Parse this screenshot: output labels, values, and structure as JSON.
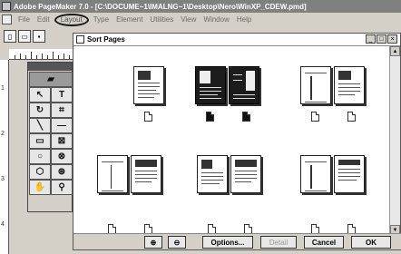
{
  "app": {
    "title": "Adobe PageMaker 7.0 - [C:\\DOCUME~1\\IMALNG~1\\Desktop\\Nero\\WinXP_CDEW.pmd]"
  },
  "menu": {
    "items": [
      "File",
      "Edit",
      "Layout",
      "Type",
      "Element",
      "Utilities",
      "View",
      "Window",
      "Help"
    ],
    "highlighted": "Layout"
  },
  "ruler": {
    "left_numbers": [
      "1",
      "2",
      "3",
      "4"
    ]
  },
  "toolbox": {
    "tools": [
      {
        "name": "pointer-tool",
        "glyph": "↖"
      },
      {
        "name": "text-tool",
        "glyph": "T"
      },
      {
        "name": "rotate-tool",
        "glyph": "↻"
      },
      {
        "name": "crop-tool",
        "glyph": "⌗"
      },
      {
        "name": "line-tool",
        "glyph": "╲"
      },
      {
        "name": "constrained-line-tool",
        "glyph": "—"
      },
      {
        "name": "rectangle-tool",
        "glyph": "▭"
      },
      {
        "name": "rectangle-frame-tool",
        "glyph": "⊠"
      },
      {
        "name": "ellipse-tool",
        "glyph": "○"
      },
      {
        "name": "ellipse-frame-tool",
        "glyph": "⊗"
      },
      {
        "name": "polygon-tool",
        "glyph": "⬡"
      },
      {
        "name": "polygon-frame-tool",
        "glyph": "⊛"
      },
      {
        "name": "hand-tool",
        "glyph": "✋"
      },
      {
        "name": "zoom-tool",
        "glyph": "🔍"
      }
    ]
  },
  "dialog": {
    "title": "Sort Pages",
    "controls": [
      "_",
      "□",
      "×"
    ],
    "footer": {
      "options_label": "Options...",
      "detail_label": "Detail",
      "cancel_label": "Cancel",
      "ok_label": "OK"
    }
  },
  "colors": {
    "title_bar": "#808080",
    "chrome": "#d4d0c8",
    "selected_spread": "#1c1c1c"
  }
}
